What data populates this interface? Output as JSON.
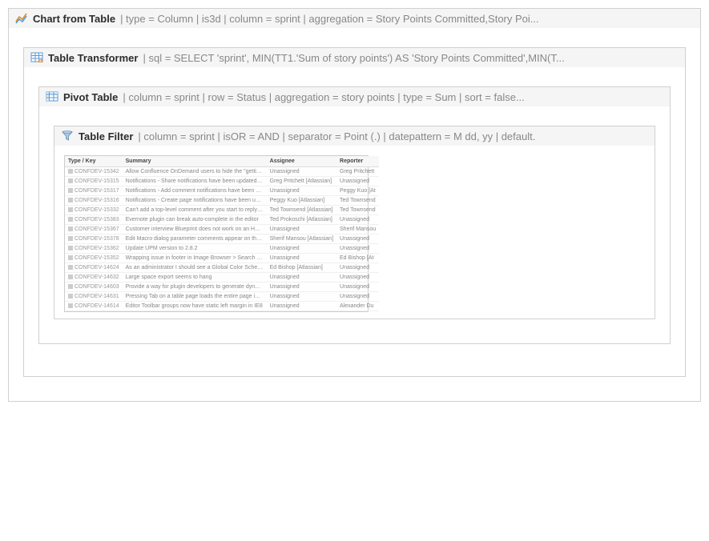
{
  "chartFromTable": {
    "title": "Chart from Table",
    "params": "| type = Column | is3d | column = sprint | aggregation = Story Points Committed,Story Poi..."
  },
  "tableTransformer": {
    "title": "Table Transformer",
    "params": "| sql = SELECT 'sprint', MIN(TT1.'Sum of story points') AS 'Story Points Committed',MIN(T..."
  },
  "pivotTable": {
    "title": "Pivot Table",
    "params": "| column = sprint | row = Status | aggregation = story points | type = Sum | sort = false..."
  },
  "tableFilter": {
    "title": "Table Filter",
    "params": "| column = sprint | isOR = AND | separator = Point (.) | datepattern = M dd, yy | default."
  },
  "jiraHeaders": {
    "typeKey": "Type / Key",
    "summary": "Summary",
    "assignee": "Assignee",
    "reporter": "Reporter"
  },
  "jiraRows": [
    {
      "key": "CONFDEV-15342",
      "summary": "Allow Confluence OnDemand users to hide the \"getting started\" page",
      "assignee": "Unassigned",
      "reporter": "Greg Pritchett"
    },
    {
      "key": "CONFDEV-15315",
      "summary": "Notifications - Share notifications have been updated to use the ADG",
      "assignee": "Greg Pritchett [Atlassian]",
      "reporter": "Unassigned"
    },
    {
      "key": "CONFDEV-15317",
      "summary": "Notifications - Add comment notifications have been updated to use the ADG",
      "assignee": "Unassigned",
      "reporter": "Peggy Kuo [At"
    },
    {
      "key": "CONFDEV-15316",
      "summary": "Notifications - Create page notifications have been updated to use the ADG",
      "assignee": "Peggy Kuo [Atlassian]",
      "reporter": "Ted Townsend"
    },
    {
      "key": "CONFDEV-15332",
      "summary": "Can't add a top-level comment after you start to reply to a comment",
      "assignee": "Ted Townsend [Atlassian]",
      "reporter": "Ted Townsend"
    },
    {
      "key": "CONFDEV-15383",
      "summary": "Evernote plugin can break auto-complete in the editor",
      "assignee": "Ted Prokoschi [Atlassian]",
      "reporter": "Unassigned"
    },
    {
      "key": "CONFDEV-15367",
      "summary": "Customer interview Blueprint does not work on an HTTPS secure",
      "assignee": "Unassigned",
      "reporter": "Sherif Mansou"
    },
    {
      "key": "CONFDEV-15378",
      "summary": "Edit Macro dialog parameter comments appear on the left with no preview",
      "assignee": "Sherif Mansou [Atlassian]",
      "reporter": "Unassigned"
    },
    {
      "key": "CONFDEV-15362",
      "summary": "Update UPM version to 2.8.2",
      "assignee": "Unassigned",
      "reporter": "Unassigned"
    },
    {
      "key": "CONFDEV-15352",
      "summary": "Wrapping issue in footer in Image Browser > Search when linking an image",
      "assignee": "Unassigned",
      "reporter": "Ed Bishop [At"
    },
    {
      "key": "CONFDEV-14624",
      "summary": "As an administrator I should see a Global Color Scheme page that matches the space color scheme page",
      "assignee": "Ed Bishop [Atlassian]",
      "reporter": "Unassigned"
    },
    {
      "key": "CONFDEV-14632",
      "summary": "Large space export seems to hang",
      "assignee": "Unassigned",
      "reporter": "Unassigned"
    },
    {
      "key": "CONFDEV-14603",
      "summary": "Provide a way for plugin developers to generate dynamic content via their blueprint",
      "assignee": "Unassigned",
      "reporter": "Unassigned"
    },
    {
      "key": "CONFDEV-14631",
      "summary": "Pressing Tab on a table page loads the entire page in a tab on Safari",
      "assignee": "Unassigned",
      "reporter": "Unassigned"
    },
    {
      "key": "CONFDEV-14614",
      "summary": "Editor Toolbar groups now have static left margin in IE8",
      "assignee": "Unassigned",
      "reporter": "Alexander Du"
    }
  ]
}
